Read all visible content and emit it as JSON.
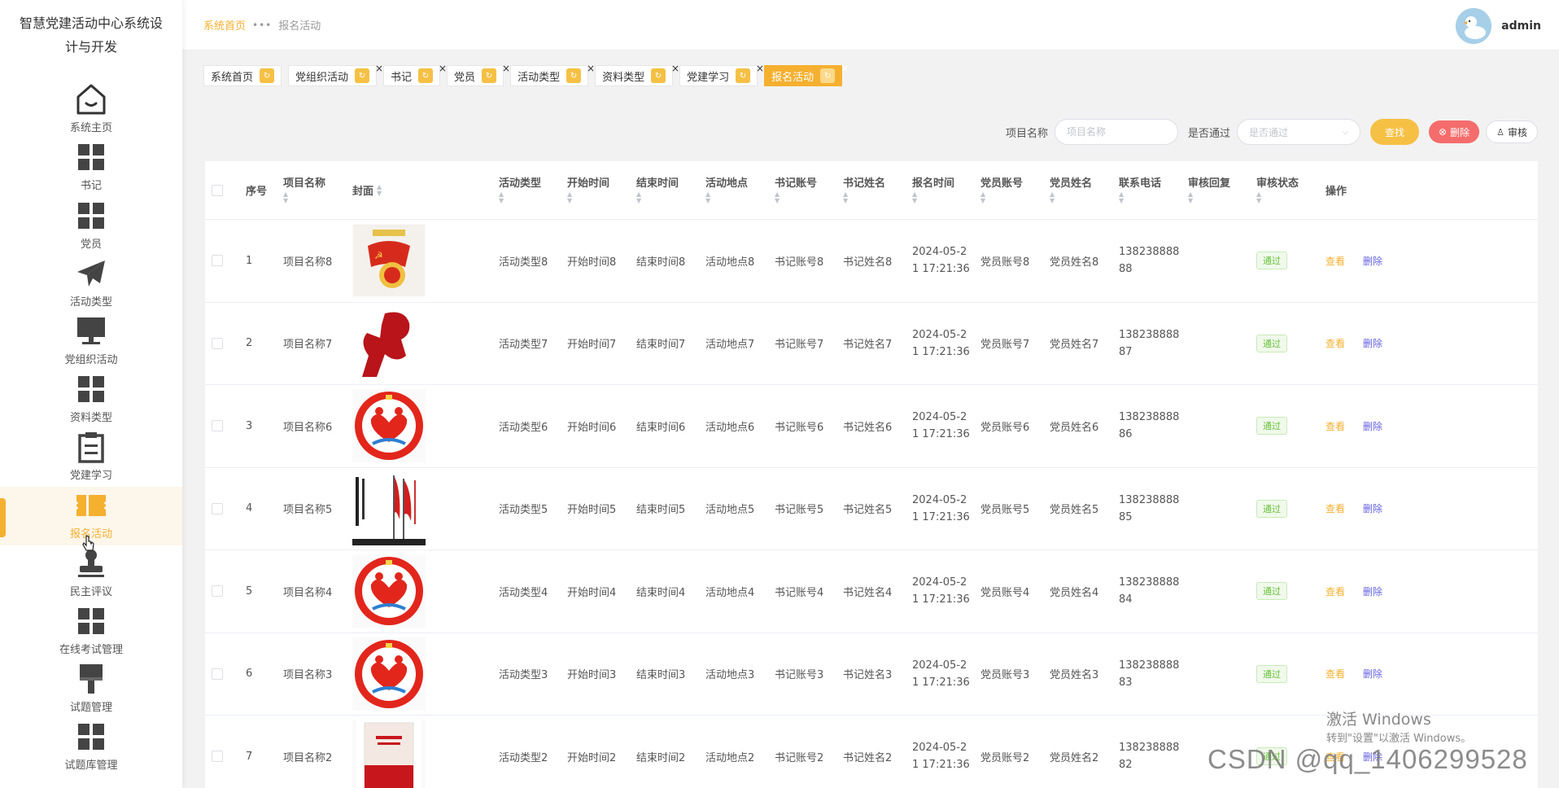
{
  "app": {
    "title": "智慧党建活动中心系统设计与开发"
  },
  "sidebar": {
    "items": [
      {
        "label": "系统主页",
        "icon": "home-icon"
      },
      {
        "label": "书记",
        "icon": "grid-icon"
      },
      {
        "label": "党员",
        "icon": "grid-icon"
      },
      {
        "label": "活动类型",
        "icon": "paper-plane-icon"
      },
      {
        "label": "党组织活动",
        "icon": "monitor-icon"
      },
      {
        "label": "资料类型",
        "icon": "grid-icon"
      },
      {
        "label": "党建学习",
        "icon": "clipboard-icon"
      },
      {
        "label": "报名活动",
        "icon": "ticket-icon"
      },
      {
        "label": "民主评议",
        "icon": "stamp-icon"
      },
      {
        "label": "在线考试管理",
        "icon": "grid-icon"
      },
      {
        "label": "试题管理",
        "icon": "brush-icon"
      },
      {
        "label": "试题库管理",
        "icon": "grid-icon"
      }
    ]
  },
  "header": {
    "breadcrumb_home": "系统首页",
    "breadcrumb_sep": "•••",
    "breadcrumb_current": "报名活动",
    "username": "admin"
  },
  "tabs": [
    {
      "label": "系统首页",
      "closable": false
    },
    {
      "label": "党组织活动",
      "closable": true
    },
    {
      "label": "书记",
      "closable": true
    },
    {
      "label": "党员",
      "closable": true
    },
    {
      "label": "活动类型",
      "closable": true
    },
    {
      "label": "资料类型",
      "closable": true
    },
    {
      "label": "党建学习",
      "closable": true
    },
    {
      "label": "报名活动",
      "closable": true
    }
  ],
  "search": {
    "name_label": "项目名称",
    "name_placeholder": "项目名称",
    "pass_label": "是否通过",
    "pass_placeholder": "是否通过",
    "find_label": "查找",
    "delete_label": "删除",
    "audit_label": "审核"
  },
  "table": {
    "headers": {
      "idx": "序号",
      "name": "项目名称",
      "cover": "封面",
      "type": "活动类型",
      "start": "开始时间",
      "end": "结束时间",
      "loc": "活动地点",
      "sacc": "书记账号",
      "sname": "书记姓名",
      "time": "报名时间",
      "macc": "党员账号",
      "mname": "党员姓名",
      "phone": "联系电话",
      "reply": "审核回复",
      "status": "审核状态",
      "ops": "操作"
    },
    "rows": [
      {
        "idx": "1",
        "name": "项目名称8",
        "type": "活动类型8",
        "start": "开始时间8",
        "end": "结束时间8",
        "loc": "活动地点8",
        "sacc": "书记账号8",
        "sname": "书记姓名8",
        "time1": "2024-05-2",
        "time2": "1 17:21:36",
        "macc": "党员账号8",
        "mname": "党员姓名8",
        "phone1": "138238888",
        "phone2": "88",
        "reply": "",
        "status": "通过",
        "cover": "badge"
      },
      {
        "idx": "2",
        "name": "项目名称7",
        "type": "活动类型7",
        "start": "开始时间7",
        "end": "结束时间7",
        "loc": "活动地点7",
        "sacc": "书记账号7",
        "sname": "书记姓名7",
        "time1": "2024-05-2",
        "time2": "1 17:21:36",
        "macc": "党员账号7",
        "mname": "党员姓名7",
        "phone1": "138238888",
        "phone2": "87",
        "reply": "",
        "status": "通过",
        "cover": "silhouette"
      },
      {
        "idx": "3",
        "name": "项目名称6",
        "type": "活动类型6",
        "start": "开始时间6",
        "end": "结束时间6",
        "loc": "活动地点6",
        "sacc": "书记账号6",
        "sname": "书记姓名6",
        "time1": "2024-05-2",
        "time2": "1 17:21:36",
        "macc": "党员账号6",
        "mname": "党员姓名6",
        "phone1": "138238888",
        "phone2": "86",
        "reply": "",
        "status": "通过",
        "cover": "logo"
      },
      {
        "idx": "4",
        "name": "项目名称5",
        "type": "活动类型5",
        "start": "开始时间5",
        "end": "结束时间5",
        "loc": "活动地点5",
        "sacc": "书记账号5",
        "sname": "书记姓名5",
        "time1": "2024-05-2",
        "time2": "1 17:21:36",
        "macc": "党员账号5",
        "mname": "党员姓名5",
        "phone1": "138238888",
        "phone2": "85",
        "reply": "",
        "status": "通过",
        "cover": "flags"
      },
      {
        "idx": "5",
        "name": "项目名称4",
        "type": "活动类型4",
        "start": "开始时间4",
        "end": "结束时间4",
        "loc": "活动地点4",
        "sacc": "书记账号4",
        "sname": "书记姓名4",
        "time1": "2024-05-2",
        "time2": "1 17:21:36",
        "macc": "党员账号4",
        "mname": "党员姓名4",
        "phone1": "138238888",
        "phone2": "84",
        "reply": "",
        "status": "通过",
        "cover": "logo"
      },
      {
        "idx": "6",
        "name": "项目名称3",
        "type": "活动类型3",
        "start": "开始时间3",
        "end": "结束时间3",
        "loc": "活动地点3",
        "sacc": "书记账号3",
        "sname": "书记姓名3",
        "time1": "2024-05-2",
        "time2": "1 17:21:36",
        "macc": "党员账号3",
        "mname": "党员姓名3",
        "phone1": "138238888",
        "phone2": "83",
        "reply": "",
        "status": "通过",
        "cover": "logo"
      },
      {
        "idx": "7",
        "name": "项目名称2",
        "type": "活动类型2",
        "start": "开始时间2",
        "end": "结束时间2",
        "loc": "活动地点2",
        "sacc": "书记账号2",
        "sname": "书记姓名2",
        "time1": "2024-05-2",
        "time2": "1 17:21:36",
        "macc": "党员账号2",
        "mname": "党员姓名2",
        "phone1": "138238888",
        "phone2": "82",
        "reply": "",
        "status": "通过",
        "cover": "book"
      }
    ],
    "view_label": "查看",
    "delete_label": "删除"
  },
  "watermarks": {
    "windows_title": "激活 Windows",
    "windows_sub": "转到\"设置\"以激活 Windows。",
    "csdn": "CSDN @qq_1406299528"
  },
  "colors": {
    "accent": "#f5b030",
    "danger": "#f56c6c",
    "success": "#67c23a",
    "link": "#6663e0"
  }
}
